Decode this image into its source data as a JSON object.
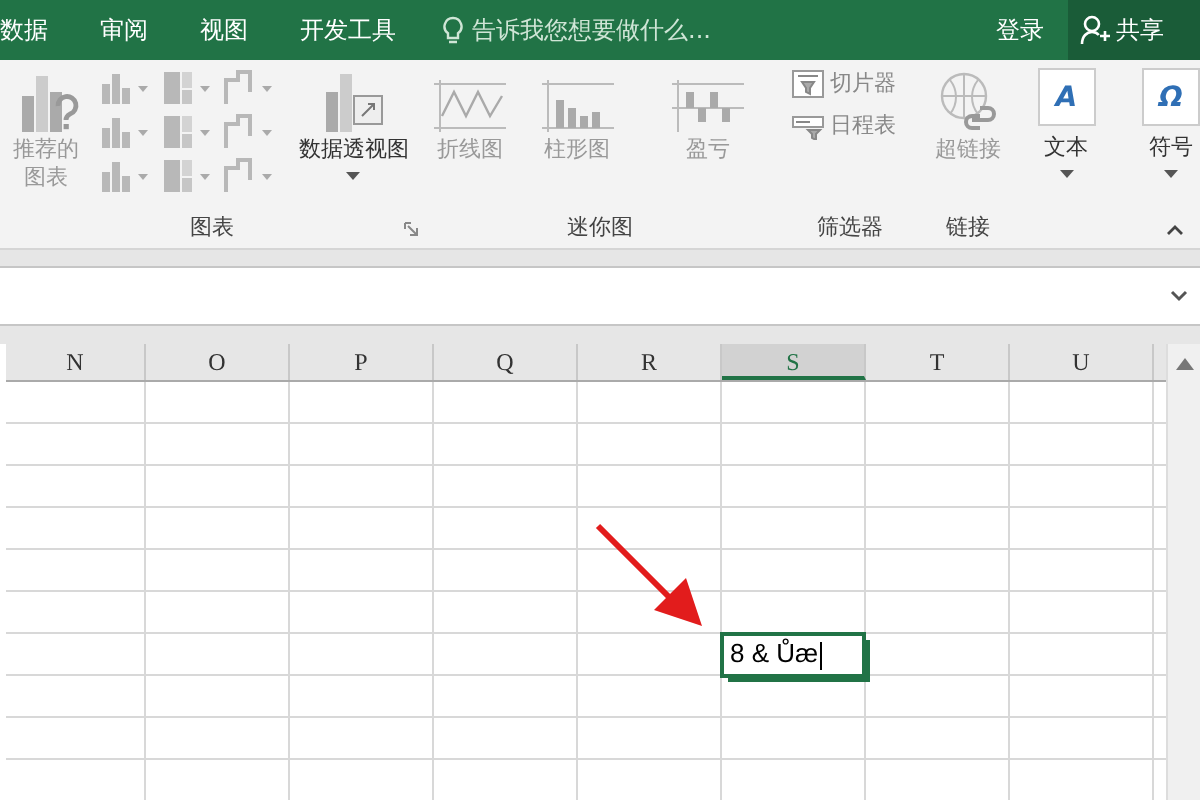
{
  "tabs": [
    {
      "label": "数据",
      "selected": false
    },
    {
      "label": "审阅",
      "selected": false
    },
    {
      "label": "视图",
      "selected": false
    },
    {
      "label": "开发工具",
      "selected": false
    }
  ],
  "tell_me": {
    "placeholder": "告诉我您想要做什么..."
  },
  "sign_in": "登录",
  "share": "共享",
  "ribbon": {
    "groups": [
      {
        "label": "图表",
        "launcher": true,
        "items": [
          {
            "kind": "large",
            "label": "推荐的图表",
            "disabled": true
          },
          {
            "kind": "gallery",
            "disabled": true
          },
          {
            "kind": "large",
            "label": "数据透视图",
            "disabled": false,
            "dropdown": true
          }
        ]
      },
      {
        "label": "迷你图",
        "items": [
          {
            "kind": "large",
            "label": "折线图",
            "disabled": true
          },
          {
            "kind": "large",
            "label": "柱形图",
            "disabled": true
          },
          {
            "kind": "large",
            "label": "盈亏",
            "disabled": true
          }
        ]
      },
      {
        "label": "筛选器",
        "items": [
          {
            "kind": "small",
            "label": "切片器",
            "disabled": true
          },
          {
            "kind": "small",
            "label": "日程表",
            "disabled": true
          }
        ]
      },
      {
        "label": "链接",
        "items": [
          {
            "kind": "large",
            "label": "超链接",
            "disabled": true
          }
        ]
      },
      {
        "items": [
          {
            "kind": "boxed",
            "glyph": "A",
            "label": "文本",
            "disabled": false,
            "dropdown": true
          }
        ]
      },
      {
        "items": [
          {
            "kind": "boxed",
            "glyph": "Ω",
            "label": "符号",
            "disabled": false,
            "dropdown": true
          }
        ]
      }
    ]
  },
  "columns": [
    {
      "label": "N",
      "selected": false
    },
    {
      "label": "O",
      "selected": false
    },
    {
      "label": "P",
      "selected": false
    },
    {
      "label": "Q",
      "selected": false
    },
    {
      "label": "R",
      "selected": false
    },
    {
      "label": "S",
      "selected": true
    },
    {
      "label": "T",
      "selected": false
    },
    {
      "label": "U",
      "selected": false
    }
  ],
  "active_cell": {
    "value": "8 & Ůæ"
  }
}
